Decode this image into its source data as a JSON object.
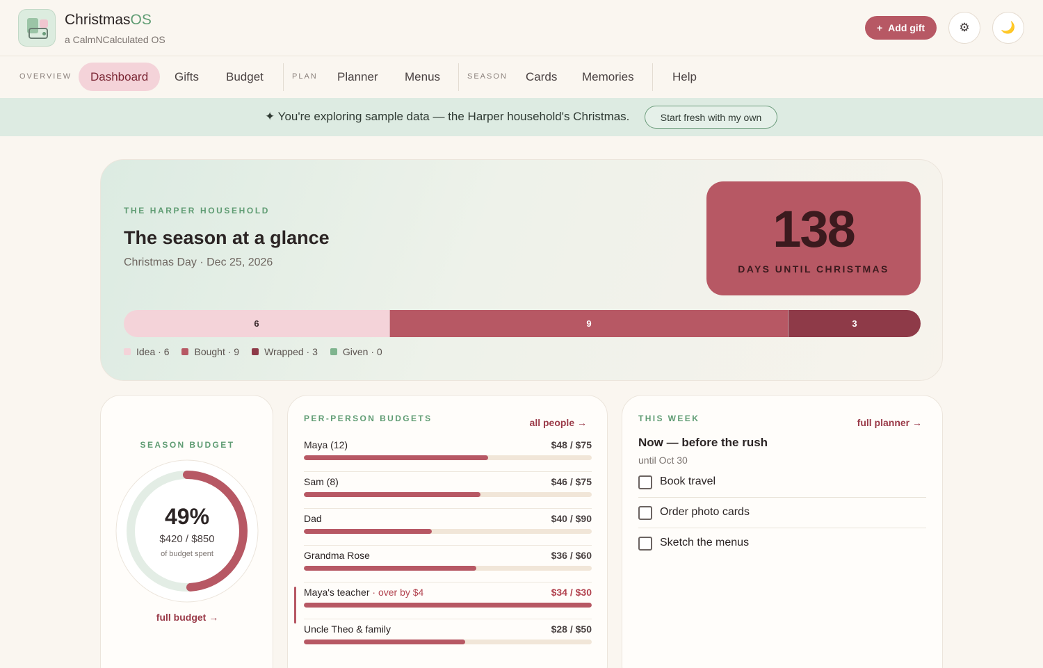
{
  "header": {
    "brand_name": "Christmas",
    "brand_os": "OS",
    "brand_sub": "a CalmNCalculated OS",
    "add_gift_icon": "+",
    "add_gift_label": "Add gift",
    "settings_icon": "⚙",
    "theme_icon": "🌙"
  },
  "nav": {
    "sections": {
      "overview": "OVERVIEW",
      "plan": "PLAN",
      "season": "SEASON"
    },
    "items": {
      "dashboard": "Dashboard",
      "gifts": "Gifts",
      "budget": "Budget",
      "planner": "Planner",
      "menus": "Menus",
      "cards": "Cards",
      "memories": "Memories",
      "help": "Help"
    },
    "active": "Dashboard"
  },
  "banner": {
    "text": "✦ You're exploring sample data — the Harper household's Christmas.",
    "button": "Start fresh with my own"
  },
  "hero": {
    "eyebrow": "THE HARPER HOUSEHOLD",
    "title": "The season at a glance",
    "subtitle": "Christmas Day · Dec 25, 2026",
    "countdown_number": "138",
    "countdown_label": "DAYS UNTIL CHRISTMAS",
    "status": [
      {
        "name": "Idea",
        "count": 6,
        "label": "Idea · 6",
        "color": "#f4d3d9",
        "text_color": "#3b2a2d"
      },
      {
        "name": "Bought",
        "count": 9,
        "label": "Bought · 9",
        "color": "#b75864",
        "text_color": "#ffffff"
      },
      {
        "name": "Wrapped",
        "count": 3,
        "label": "Wrapped · 3",
        "color": "#8e3a48",
        "text_color": "#ffffff"
      },
      {
        "name": "Given",
        "count": 0,
        "label": "Given · 0",
        "color": "#7fb48e",
        "text_color": "#ffffff"
      }
    ]
  },
  "season_budget": {
    "eyebrow": "SEASON BUDGET",
    "percent_label": "49%",
    "percent_value": 0.49,
    "amount": "$420 / $850",
    "caption": "of budget spent",
    "link": "full budget →"
  },
  "per_person": {
    "eyebrow": "PER-PERSON BUDGETS",
    "link": "all people →",
    "rows": [
      {
        "name": "Maya (12)",
        "amount": "$48 / $75",
        "fraction": 0.64,
        "over": false,
        "note": ""
      },
      {
        "name": "Sam (8)",
        "amount": "$46 / $75",
        "fraction": 0.613,
        "over": false,
        "note": ""
      },
      {
        "name": "Dad",
        "amount": "$40 / $90",
        "fraction": 0.444,
        "over": false,
        "note": ""
      },
      {
        "name": "Grandma Rose",
        "amount": "$36 / $60",
        "fraction": 0.6,
        "over": false,
        "note": ""
      },
      {
        "name": "Maya's teacher",
        "amount": "$34 / $30",
        "fraction": 1.0,
        "over": true,
        "note": " · over by $4"
      },
      {
        "name": "Uncle Theo & family",
        "amount": "$28 / $50",
        "fraction": 0.56,
        "over": false,
        "note": ""
      }
    ]
  },
  "this_week": {
    "eyebrow": "THIS WEEK",
    "link": "full planner →",
    "title": "Now — before the rush",
    "subtitle": "until Oct 30",
    "tasks": [
      {
        "label": "Book travel",
        "done": false
      },
      {
        "label": "Order photo cards",
        "done": false
      },
      {
        "label": "Sketch the menus",
        "done": false
      }
    ]
  }
}
